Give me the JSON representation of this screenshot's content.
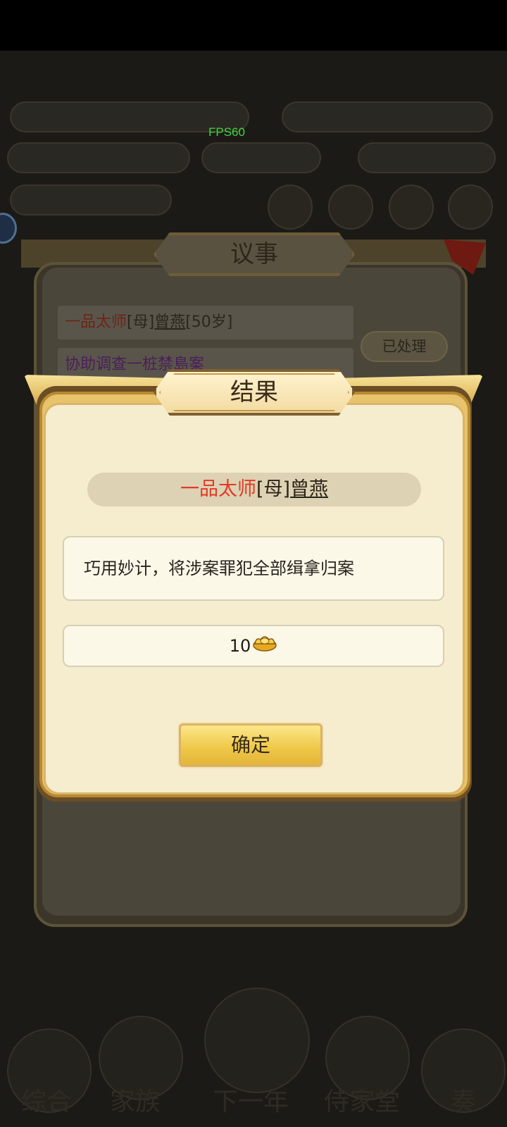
{
  "overlay": {
    "fps": "FPS60"
  },
  "background": {
    "bottom_nav": [
      "综合",
      "家族",
      "下一年",
      "侍家堂",
      "奏"
    ]
  },
  "yishi_dialog": {
    "title": "议事",
    "rank_title": "一品太师",
    "relation": "[母]",
    "person_name": "曾燕",
    "age": "[50岁]",
    "task": "协助调查一桩禁島案",
    "handled_label": "已处理"
  },
  "result_dialog": {
    "title": "结果",
    "rank_title": "一品太师",
    "relation": "[母]",
    "person_name": "曾燕",
    "description": "巧用妙计，将涉案罪犯全部缉拿归案",
    "reward_amount": "10",
    "reward_icon": "gold-ingot-icon",
    "confirm_label": "确定"
  },
  "colors": {
    "rank_red": "#e23a26",
    "panel_cream": "#f6edce",
    "gold": "#eec746"
  }
}
